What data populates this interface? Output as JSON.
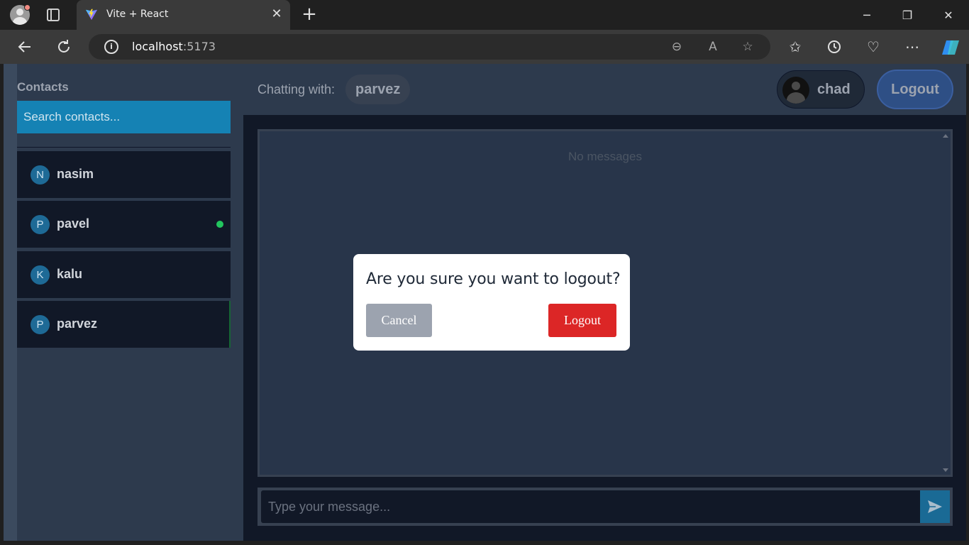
{
  "browser": {
    "tab_title": "Vite + React",
    "url_host": "localhost",
    "url_port": ":5173"
  },
  "sidebar": {
    "title": "Contacts",
    "search_placeholder": "Search contacts...",
    "contacts": [
      {
        "initial": "N",
        "name": "nasim",
        "online": false
      },
      {
        "initial": "P",
        "name": "pavel",
        "online": true
      },
      {
        "initial": "K",
        "name": "kalu",
        "online": false
      },
      {
        "initial": "P",
        "name": "parvez",
        "online": false,
        "active": true
      }
    ]
  },
  "header": {
    "chatting_label": "Chatting with:",
    "chatting_with": "parvez",
    "user_name": "chad",
    "logout_label": "Logout"
  },
  "chat": {
    "empty_text": "No messages",
    "input_placeholder": "Type your message..."
  },
  "modal": {
    "title": "Are you sure you want to logout?",
    "cancel_label": "Cancel",
    "logout_label": "Logout"
  },
  "colors": {
    "accent_blue": "#1582b4",
    "online_green": "#22c55e",
    "danger_red": "#dc2626"
  }
}
